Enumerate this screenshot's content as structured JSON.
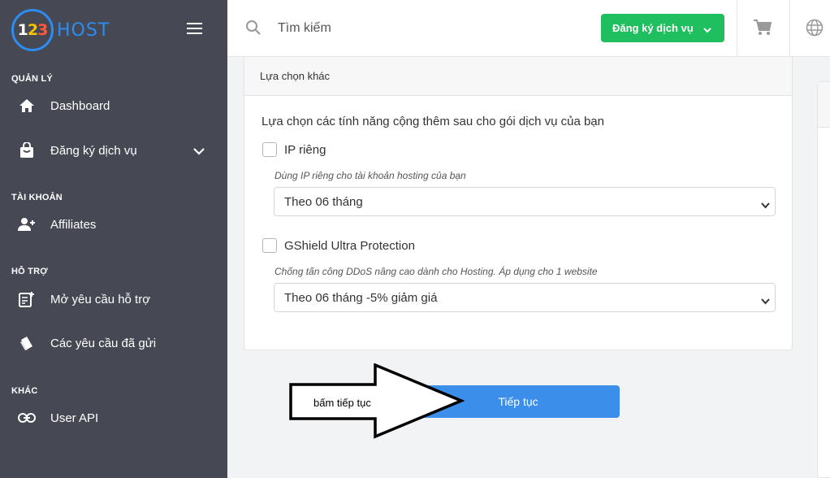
{
  "brand": {
    "logo_digits": [
      "1",
      "2",
      "3"
    ],
    "logo_text": "HOST",
    "accent": "#2d8cf0"
  },
  "sidebar": {
    "sections": [
      {
        "label": "QUẢN LÝ"
      },
      {
        "label": "TÀI KHOẢN"
      },
      {
        "label": "HỖ TRỢ"
      },
      {
        "label": "KHÁC"
      }
    ],
    "items": [
      {
        "label": "Dashboard",
        "icon": "home-icon"
      },
      {
        "label": "Đăng ký dịch vụ",
        "icon": "shopping-bag-icon",
        "has_submenu": true
      },
      {
        "label": "Affiliates",
        "icon": "user-plus-icon"
      },
      {
        "label": "Mở yêu cầu hỗ trợ",
        "icon": "edit-ticket-icon"
      },
      {
        "label": "Các yêu cầu đã gửi",
        "icon": "tickets-icon"
      },
      {
        "label": "User API",
        "icon": "link-icon"
      }
    ],
    "bg_color": "#464953"
  },
  "header": {
    "search": {
      "placeholder": "Tìm kiếm",
      "value": ""
    },
    "register_button": "Đăng ký dịch vụ",
    "register_color": "#1fbe5e",
    "cart_icon": "cart-icon",
    "language_icon": "globe-icon"
  },
  "main": {
    "card_title": "Lựa chọn khác",
    "intro": "Lựa chọn các tính năng cộng thêm sau cho gói dịch vụ của bạn",
    "addons": [
      {
        "label": "IP riêng",
        "checked": false,
        "hint": "Dùng IP riêng cho tài khoản hosting của bạn",
        "selected": "Theo 06 tháng"
      },
      {
        "label": "GShield Ultra Protection",
        "checked": false,
        "hint": "Chống tấn công DDoS nâng cao dành cho Hosting. Áp dụng cho 1 website",
        "selected": "Theo 06 tháng -5% giảm giá"
      }
    ],
    "continue_button": "Tiếp tục",
    "continue_color": "#3b8eea"
  },
  "annotation": {
    "text": "bấm tiếp tục"
  }
}
